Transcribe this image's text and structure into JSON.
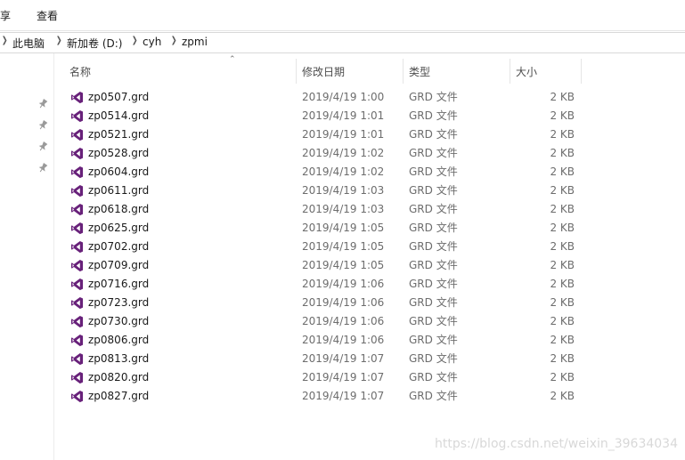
{
  "ribbon": {
    "tabs": [
      {
        "label": "享"
      },
      {
        "label": "查看"
      }
    ]
  },
  "address": {
    "parts": [
      "此电脑",
      "新加卷 (D:)",
      "cyh",
      "zpmi"
    ]
  },
  "columns": {
    "name": "名称",
    "date": "修改日期",
    "type": "类型",
    "size": "大小"
  },
  "files": [
    {
      "name": "zp0507.grd",
      "date": "2019/4/19 1:00",
      "type": "GRD 文件",
      "size": "2 KB"
    },
    {
      "name": "zp0514.grd",
      "date": "2019/4/19 1:01",
      "type": "GRD 文件",
      "size": "2 KB"
    },
    {
      "name": "zp0521.grd",
      "date": "2019/4/19 1:01",
      "type": "GRD 文件",
      "size": "2 KB"
    },
    {
      "name": "zp0528.grd",
      "date": "2019/4/19 1:02",
      "type": "GRD 文件",
      "size": "2 KB"
    },
    {
      "name": "zp0604.grd",
      "date": "2019/4/19 1:02",
      "type": "GRD 文件",
      "size": "2 KB"
    },
    {
      "name": "zp0611.grd",
      "date": "2019/4/19 1:03",
      "type": "GRD 文件",
      "size": "2 KB"
    },
    {
      "name": "zp0618.grd",
      "date": "2019/4/19 1:03",
      "type": "GRD 文件",
      "size": "2 KB"
    },
    {
      "name": "zp0625.grd",
      "date": "2019/4/19 1:05",
      "type": "GRD 文件",
      "size": "2 KB"
    },
    {
      "name": "zp0702.grd",
      "date": "2019/4/19 1:05",
      "type": "GRD 文件",
      "size": "2 KB"
    },
    {
      "name": "zp0709.grd",
      "date": "2019/4/19 1:05",
      "type": "GRD 文件",
      "size": "2 KB"
    },
    {
      "name": "zp0716.grd",
      "date": "2019/4/19 1:06",
      "type": "GRD 文件",
      "size": "2 KB"
    },
    {
      "name": "zp0723.grd",
      "date": "2019/4/19 1:06",
      "type": "GRD 文件",
      "size": "2 KB"
    },
    {
      "name": "zp0730.grd",
      "date": "2019/4/19 1:06",
      "type": "GRD 文件",
      "size": "2 KB"
    },
    {
      "name": "zp0806.grd",
      "date": "2019/4/19 1:06",
      "type": "GRD 文件",
      "size": "2 KB"
    },
    {
      "name": "zp0813.grd",
      "date": "2019/4/19 1:07",
      "type": "GRD 文件",
      "size": "2 KB"
    },
    {
      "name": "zp0820.grd",
      "date": "2019/4/19 1:07",
      "type": "GRD 文件",
      "size": "2 KB"
    },
    {
      "name": "zp0827.grd",
      "date": "2019/4/19 1:07",
      "type": "GRD 文件",
      "size": "2 KB"
    }
  ],
  "icons": {
    "file": "visual-studio-file-icon",
    "pin": "pin-icon",
    "chevron": "chevron-right-icon",
    "sort": "sort-up-icon"
  },
  "colors": {
    "file_icon": "#68217a",
    "accent_hover": "#e5f3ff"
  },
  "watermark": "https://blog.csdn.net/weixin_39634034"
}
